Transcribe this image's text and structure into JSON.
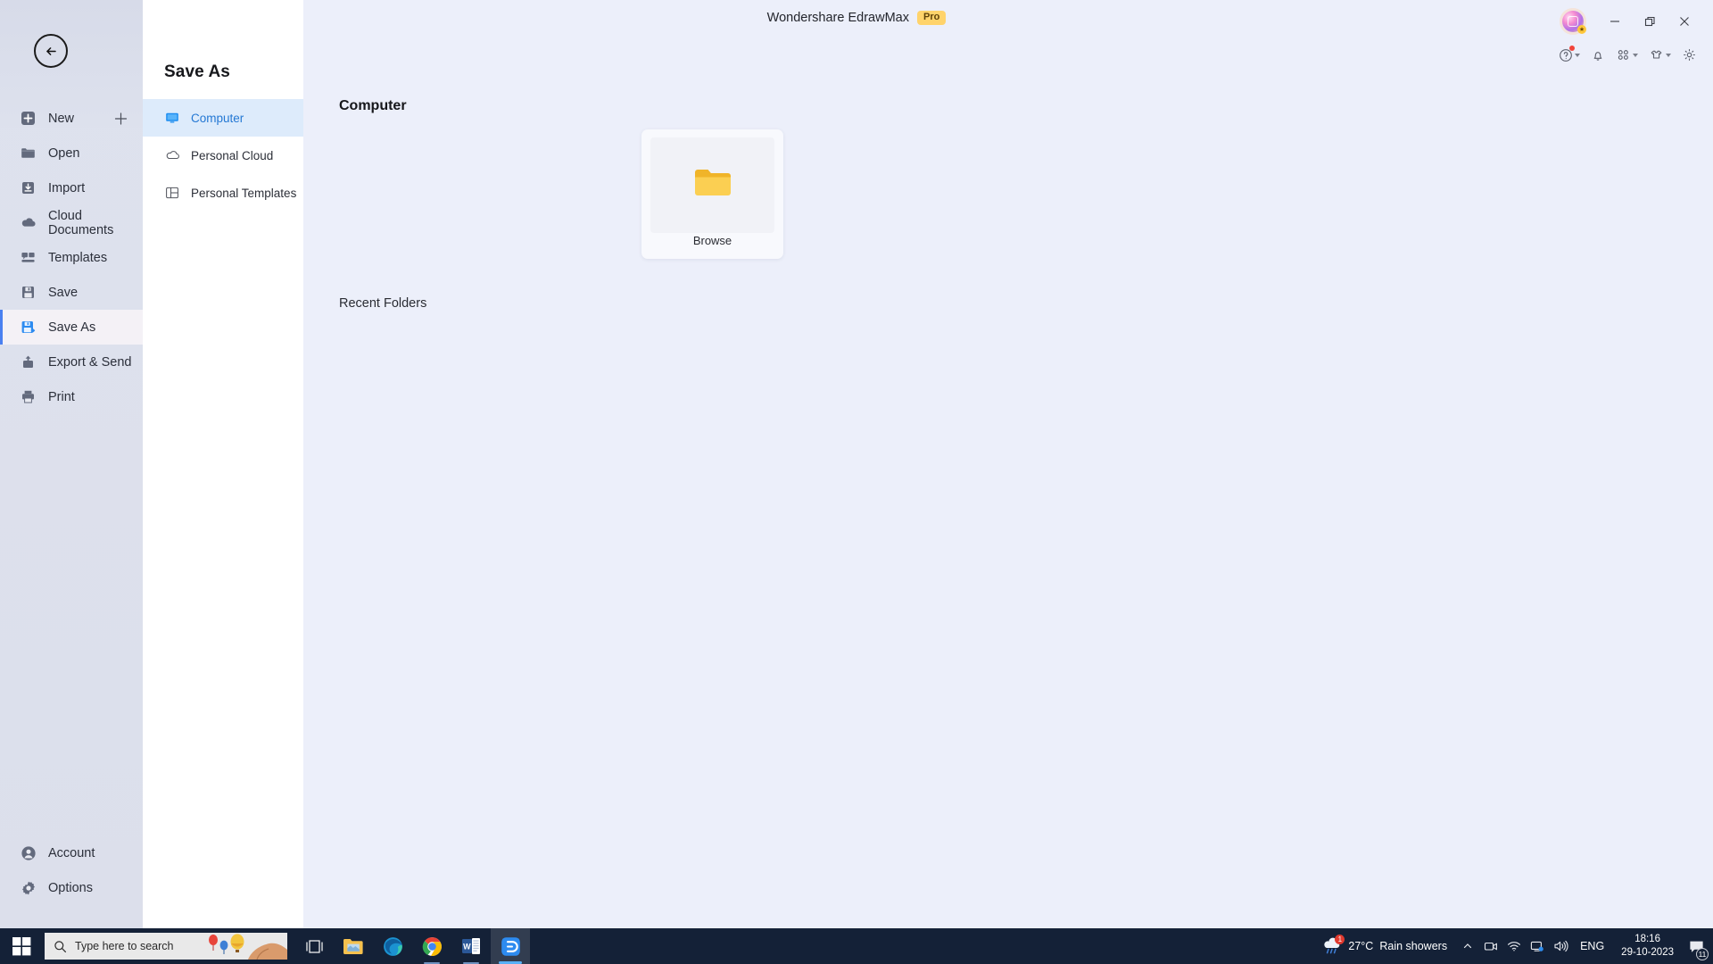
{
  "window": {
    "title": "Wondershare EdrawMax",
    "edition_badge": "Pro",
    "controls": {
      "minimize": "Minimize",
      "restore": "Restore",
      "close": "Close"
    }
  },
  "toolbar": {
    "items": [
      {
        "name": "help-icon",
        "label": "Help",
        "has_caret": true,
        "has_dot": true
      },
      {
        "name": "notification-bell-icon",
        "label": "Notifications",
        "has_caret": false,
        "has_dot": false
      },
      {
        "name": "apps-grid-icon",
        "label": "Apps",
        "has_caret": true,
        "has_dot": false
      },
      {
        "name": "theme-shirt-icon",
        "label": "Theme",
        "has_caret": true,
        "has_dot": false
      },
      {
        "name": "settings-gear-icon",
        "label": "Settings",
        "has_caret": false,
        "has_dot": false
      }
    ]
  },
  "backstage": {
    "back_label": "Back",
    "items": [
      {
        "label": "New",
        "icon": "new-icon",
        "selected": false,
        "has_plus": true
      },
      {
        "label": "Open",
        "icon": "open-folder-icon",
        "selected": false,
        "has_plus": false
      },
      {
        "label": "Import",
        "icon": "import-icon",
        "selected": false,
        "has_plus": false
      },
      {
        "label": "Cloud Documents",
        "icon": "cloud-icon",
        "selected": false,
        "has_plus": false
      },
      {
        "label": "Templates",
        "icon": "templates-icon",
        "selected": false,
        "has_plus": false
      },
      {
        "label": "Save",
        "icon": "save-icon",
        "selected": false,
        "has_plus": false
      },
      {
        "label": "Save As",
        "icon": "save-as-icon",
        "selected": true,
        "has_plus": false
      },
      {
        "label": "Export & Send",
        "icon": "export-send-icon",
        "selected": false,
        "has_plus": false
      },
      {
        "label": "Print",
        "icon": "print-icon",
        "selected": false,
        "has_plus": false
      }
    ],
    "bottom_items": [
      {
        "label": "Account",
        "icon": "account-icon"
      },
      {
        "label": "Options",
        "icon": "options-gear-icon"
      }
    ]
  },
  "sub_panel": {
    "title": "Save As",
    "items": [
      {
        "label": "Computer",
        "icon": "monitor-icon",
        "active": true
      },
      {
        "label": "Personal Cloud",
        "icon": "cloud-outline-icon",
        "active": false
      },
      {
        "label": "Personal Templates",
        "icon": "template-layout-icon",
        "active": false
      }
    ]
  },
  "content": {
    "section_title": "Computer",
    "browse_card": {
      "label": "Browse",
      "icon": "folder-icon"
    },
    "recent_folders_title": "Recent Folders",
    "recent_folders": []
  },
  "taskbar": {
    "start_label": "Start",
    "search_placeholder": "Type here to search",
    "apps": [
      {
        "name": "task-view-icon",
        "label": "Task View",
        "state": "idle"
      },
      {
        "name": "file-explorer-icon",
        "label": "File Explorer",
        "state": "idle"
      },
      {
        "name": "microsoft-edge-icon",
        "label": "Microsoft Edge",
        "state": "idle"
      },
      {
        "name": "google-chrome-icon",
        "label": "Google Chrome",
        "state": "open"
      },
      {
        "name": "microsoft-word-icon",
        "label": "Microsoft Word",
        "state": "open"
      },
      {
        "name": "edrawmax-icon",
        "label": "EdrawMax",
        "state": "active"
      }
    ],
    "tray": {
      "weather_temp": "27°C",
      "weather_desc": "Rain showers",
      "weather_badge": "1",
      "language": "ENG",
      "time": "18:16",
      "date": "29-10-2023",
      "notification_count": "11"
    }
  },
  "colors": {
    "accent": "#2478d4",
    "active_item_bg": "#ddebfb",
    "pro_badge": "#ffd36b",
    "folder_yellow": "#f7c747",
    "taskbar": "#142137",
    "content_bg": "#eceffa"
  }
}
